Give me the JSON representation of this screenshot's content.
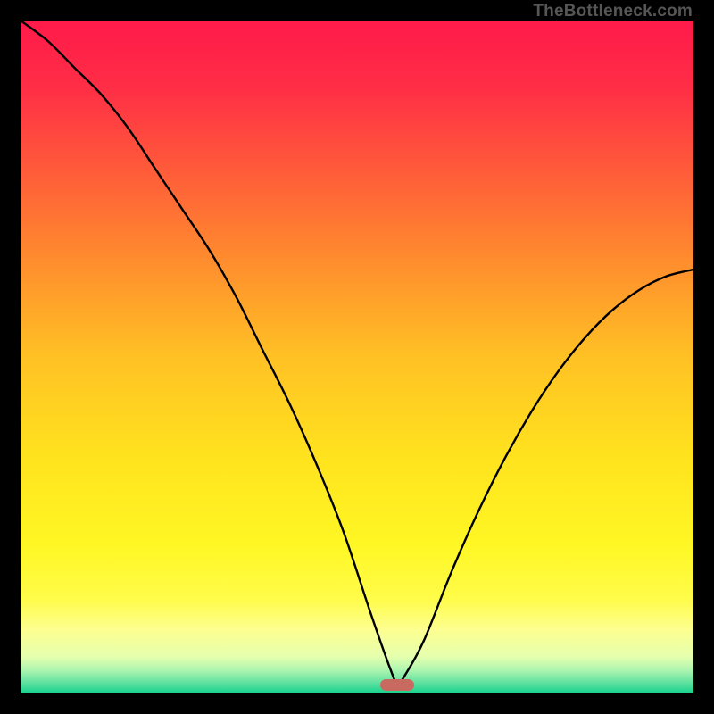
{
  "watermark": "TheBottleneck.com",
  "colors": {
    "gradient_stops": [
      {
        "offset": 0.0,
        "color": "#ff1a4a"
      },
      {
        "offset": 0.1,
        "color": "#ff2e46"
      },
      {
        "offset": 0.22,
        "color": "#ff5a3a"
      },
      {
        "offset": 0.35,
        "color": "#ff8a2e"
      },
      {
        "offset": 0.5,
        "color": "#ffc124"
      },
      {
        "offset": 0.65,
        "color": "#ffe31e"
      },
      {
        "offset": 0.78,
        "color": "#fff724"
      },
      {
        "offset": 0.86,
        "color": "#fffc4a"
      },
      {
        "offset": 0.905,
        "color": "#fdff90"
      },
      {
        "offset": 0.945,
        "color": "#e6ffae"
      },
      {
        "offset": 0.965,
        "color": "#aef5b0"
      },
      {
        "offset": 0.982,
        "color": "#69e3a2"
      },
      {
        "offset": 1.0,
        "color": "#15d18e"
      }
    ],
    "curve_stroke": "#000000",
    "marker": "#C96A60"
  },
  "chart_data": {
    "type": "line",
    "title": "",
    "xlabel": "",
    "ylabel": "",
    "xlim": [
      0,
      100
    ],
    "ylim": [
      0,
      100
    ],
    "optimal_x": 56,
    "marker": {
      "x_start": 53.5,
      "x_end": 58.5,
      "y": 1.3
    },
    "series": [
      {
        "name": "bottleneck-curve",
        "x": [
          0,
          4,
          8,
          12,
          16,
          20,
          24,
          28,
          32,
          36,
          40,
          44,
          48,
          52,
          55,
          56,
          57,
          60,
          64,
          68,
          72,
          76,
          80,
          84,
          88,
          92,
          96,
          100
        ],
        "y": [
          100,
          97,
          93,
          89,
          84,
          78,
          72,
          66,
          59,
          51,
          43,
          34,
          24,
          12,
          3.5,
          1.5,
          2.5,
          8,
          18,
          27,
          35,
          42,
          48,
          53,
          57,
          60,
          62,
          63
        ]
      }
    ]
  }
}
